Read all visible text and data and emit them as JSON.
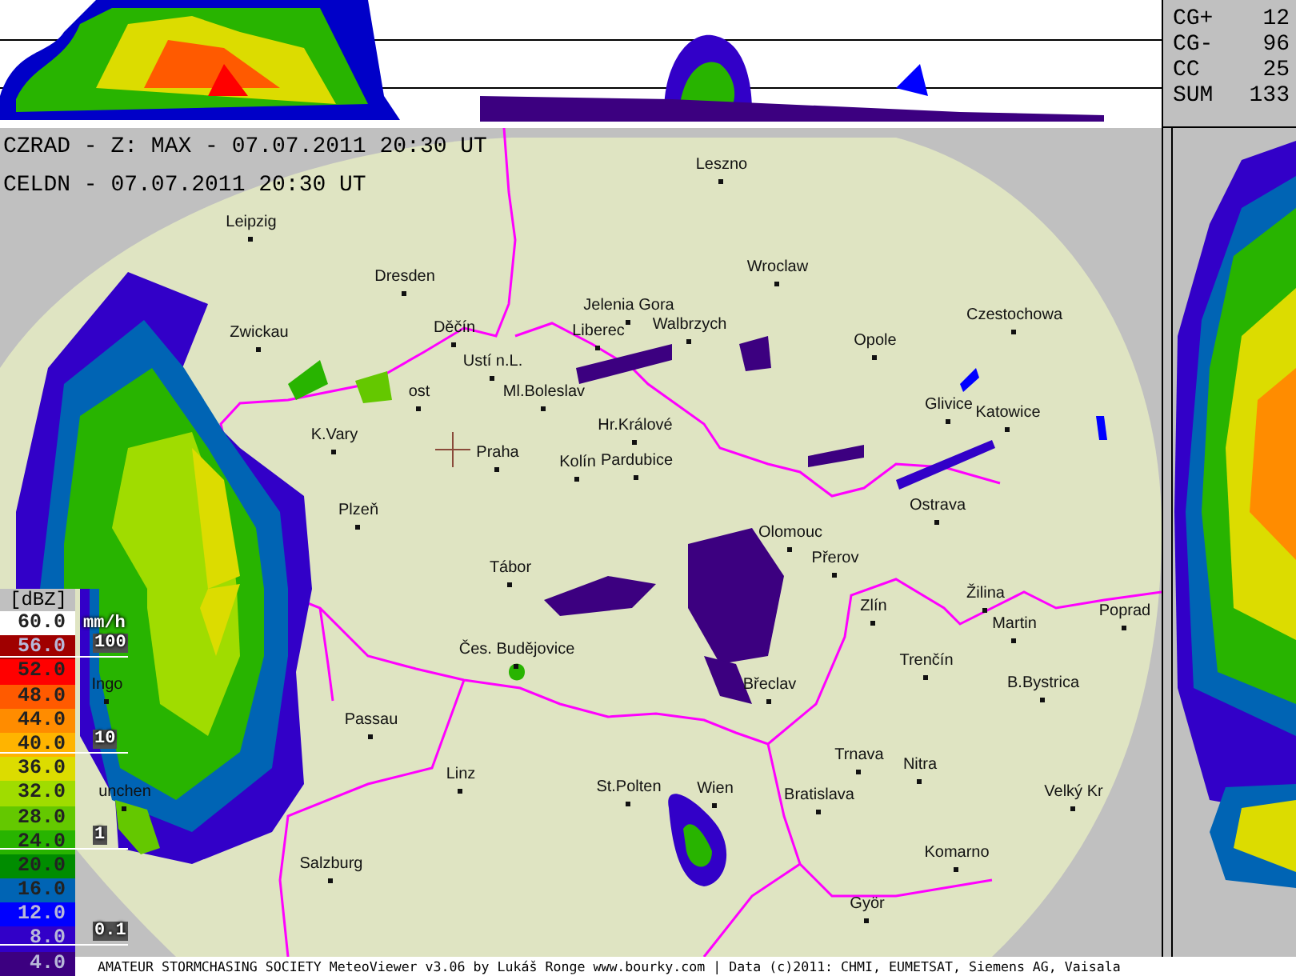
{
  "header": {
    "lines": [
      "CZRAD - Z: MAX - 07.07.2011 20:30 UT",
      "CELDN - 07.07.2011 20:30 UT"
    ]
  },
  "lightning_stats": [
    {
      "label": "CG+",
      "value": "12"
    },
    {
      "label": "CG-",
      "value": "96"
    },
    {
      "label": "CC",
      "value": "25"
    },
    {
      "label": "SUM",
      "value": "133"
    }
  ],
  "map": {
    "cities": [
      {
        "name": "Leszno"
      },
      {
        "name": "Leipzig"
      },
      {
        "name": "Dresden"
      },
      {
        "name": "Wroclaw"
      },
      {
        "name": "Jelenia Gora"
      },
      {
        "name": "Zwickau"
      },
      {
        "name": "Děčín"
      },
      {
        "name": "Liberec"
      },
      {
        "name": "Walbrzych"
      },
      {
        "name": "Opole"
      },
      {
        "name": "Czestochowa"
      },
      {
        "name": "Ustí n.L."
      },
      {
        "name": "ost"
      },
      {
        "name": "Ml.Boleslav"
      },
      {
        "name": "Glivice"
      },
      {
        "name": "Katowice"
      },
      {
        "name": "K.Vary"
      },
      {
        "name": "Hr.Králové"
      },
      {
        "name": "Praha"
      },
      {
        "name": "Kolín"
      },
      {
        "name": "Pardubice"
      },
      {
        "name": "Plzeň"
      },
      {
        "name": "Ostrava"
      },
      {
        "name": "Olomouc"
      },
      {
        "name": "Přerov"
      },
      {
        "name": "Tábor"
      },
      {
        "name": "Zlín"
      },
      {
        "name": "Žilina"
      },
      {
        "name": "Martin"
      },
      {
        "name": "Poprad"
      },
      {
        "name": "Ingo"
      },
      {
        "name": "Čes. Budějovice"
      },
      {
        "name": "Břeclav"
      },
      {
        "name": "Trenčín"
      },
      {
        "name": "B.Bystrica"
      },
      {
        "name": "Passau"
      },
      {
        "name": "unchen"
      },
      {
        "name": "Linz"
      },
      {
        "name": "St.Polten"
      },
      {
        "name": "Wien"
      },
      {
        "name": "Bratislava"
      },
      {
        "name": "Trnava"
      },
      {
        "name": "Nitra"
      },
      {
        "name": "Velký Kr"
      },
      {
        "name": "Salzburg"
      },
      {
        "name": "Komarno"
      },
      {
        "name": "Györ"
      }
    ]
  },
  "legend": {
    "unit": "[dBZ]",
    "levels": [
      {
        "value": "60.0",
        "color": "#ffffff"
      },
      {
        "value": "56.0",
        "color": "#a00000"
      },
      {
        "value": "52.0",
        "color": "#ff0000"
      },
      {
        "value": "48.0",
        "color": "#ff5a00"
      },
      {
        "value": "44.0",
        "color": "#ff8c00"
      },
      {
        "value": "40.0",
        "color": "#ffb400"
      },
      {
        "value": "36.0",
        "color": "#dcdc00"
      },
      {
        "value": "32.0",
        "color": "#a0dc00"
      },
      {
        "value": "28.0",
        "color": "#64c800"
      },
      {
        "value": "24.0",
        "color": "#28b400"
      },
      {
        "value": "20.0",
        "color": "#008c00"
      },
      {
        "value": "16.0",
        "color": "#0064b4"
      },
      {
        "value": "12.0",
        "color": "#0000ff"
      },
      {
        "value": "8.0",
        "color": "#3200c8"
      },
      {
        "value": "4.0",
        "color": "#3c0080"
      }
    ],
    "rain_unit": "mm/h",
    "rain_marks": [
      "100",
      "10",
      "1",
      "0.1"
    ]
  },
  "status_bar": "AMATEUR STORMCHASING SOCIETY MeteoViewer v3.06 by Lukáš Ronge www.bourky.com | Data (c)2011: CHMI, EUMETSAT, Siemens AG, Vaisala"
}
